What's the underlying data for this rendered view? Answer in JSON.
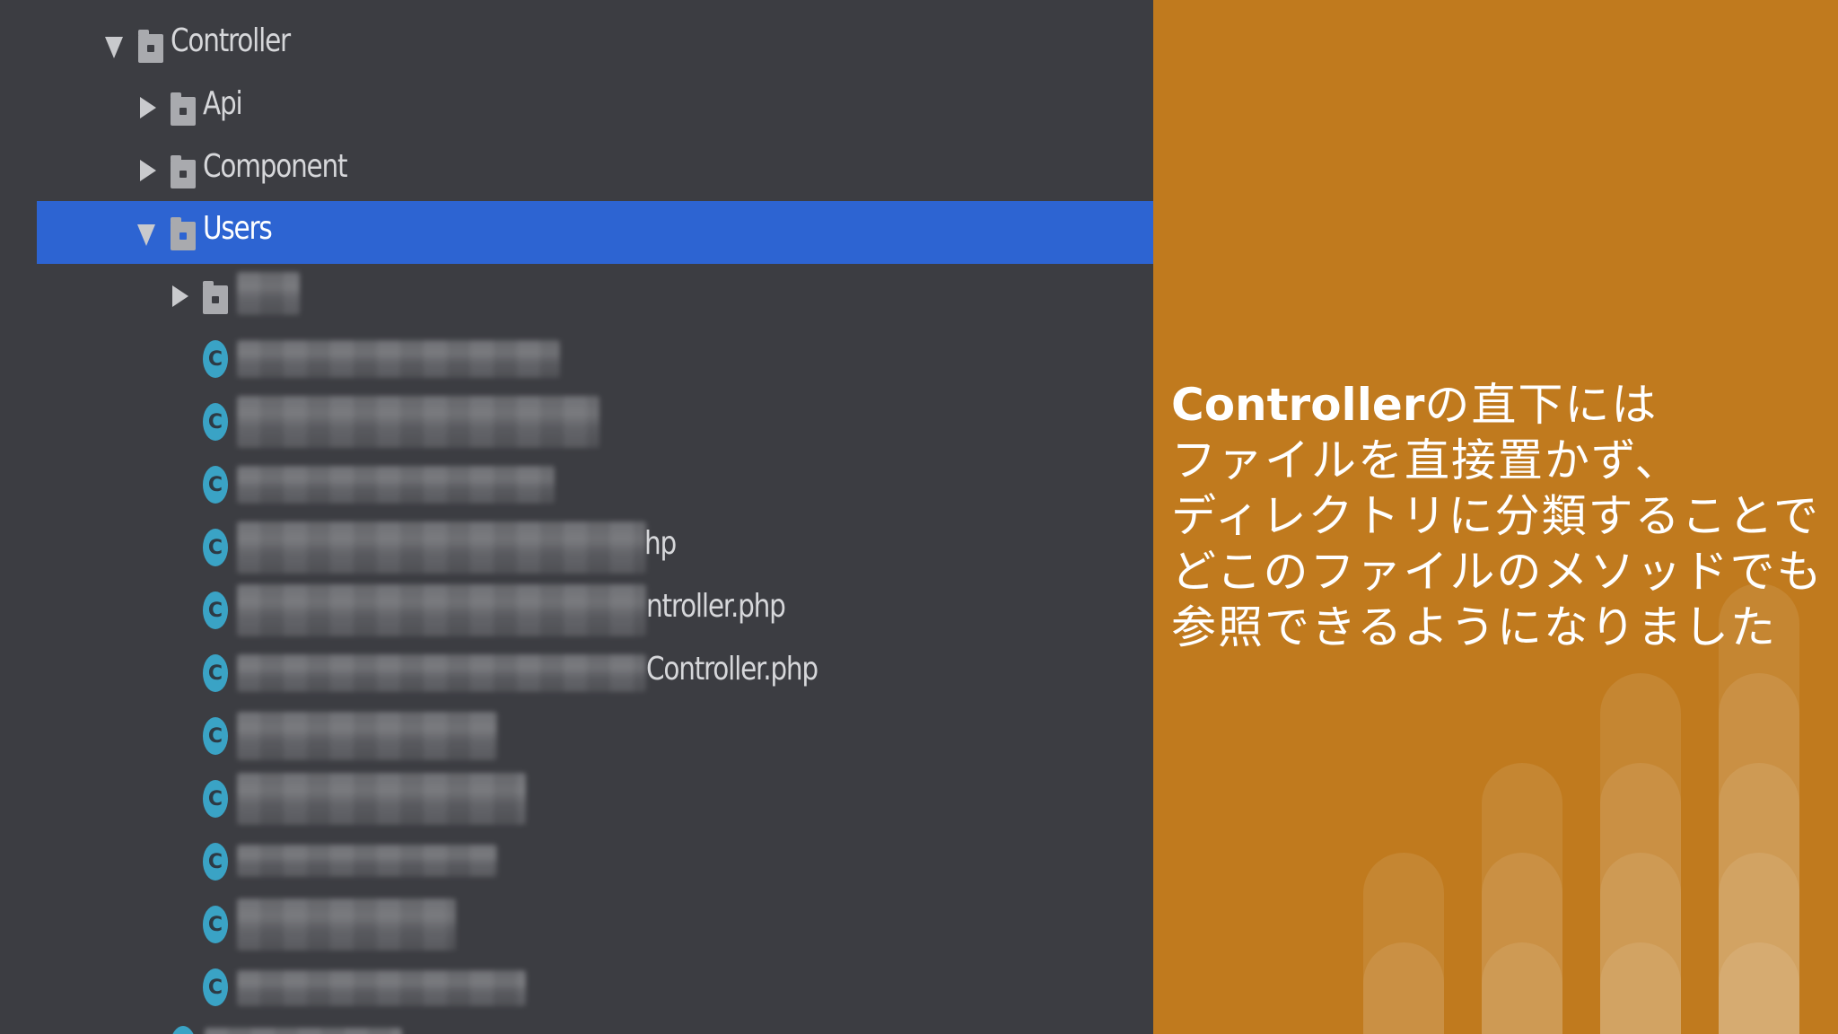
{
  "tree": {
    "controller_label": "Controller",
    "api_label": "Api",
    "component_label": "Component",
    "users_label": "Users",
    "file_icon_letter": "C",
    "file_suffix_1": "hp",
    "file_suffix_2": "ntroller.php",
    "file_suffix_3": "Controller.php"
  },
  "caption": {
    "line1_bold": "Controller",
    "line1_rest": "の直下には",
    "line2": "ファイルを直接置かず、",
    "line3": "ディレクトリに分類することで",
    "line4": "どこのファイルのメソッドでも",
    "line5": "参照できるようになりました"
  },
  "colors": {
    "tree_background": "#3c3d42",
    "selection": "#2d64d2",
    "panel": "#c07a1e",
    "class_icon": "#3aa3c5"
  }
}
